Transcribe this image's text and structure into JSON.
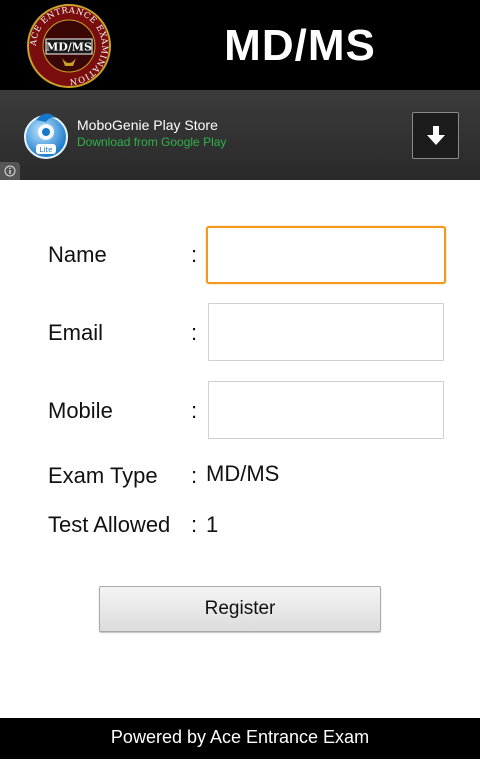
{
  "header": {
    "title": "MD/MS",
    "logo": {
      "ring_text": "ACE ENTRANCE EXAMINATION",
      "center_text": "MD/MS",
      "colors": {
        "ring": "#7a0d0d",
        "border": "#c9a227",
        "text": "#ffffff"
      }
    }
  },
  "ad": {
    "title": "MoboGenie Play Store",
    "subtitle": "Download from Google Play",
    "icon_badge": "Lite",
    "download_icon": "download-arrow-icon",
    "info_icon": "info-icon",
    "colors": {
      "subtitle": "#2fb24a"
    }
  },
  "form": {
    "name_label": "Name",
    "email_label": "Email",
    "mobile_label": "Mobile",
    "exam_type_label": "Exam Type",
    "exam_type_value": "MD/MS",
    "test_allowed_label": "Test Allowed",
    "test_allowed_value": "1",
    "colon": ":",
    "name_value": "",
    "email_value": "",
    "mobile_value": ""
  },
  "register_label": "Register",
  "footer": {
    "text": "Powered by Ace Entrance Exam"
  },
  "colors": {
    "focus": "#f39a1e",
    "header_bg": "#000000"
  }
}
